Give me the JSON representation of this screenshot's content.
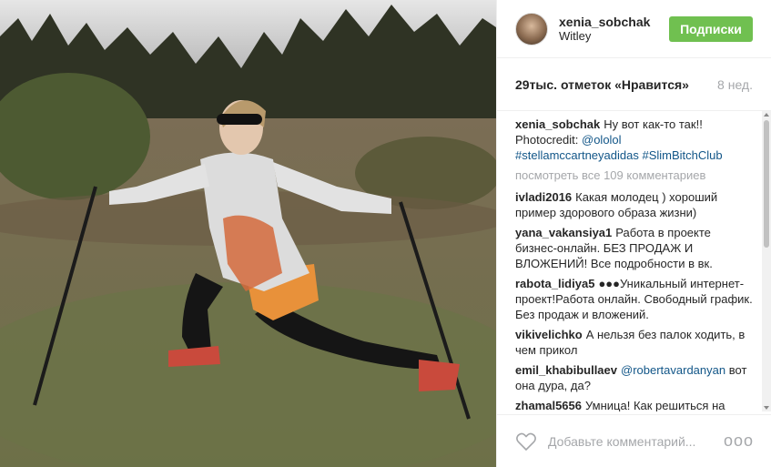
{
  "post": {
    "username": "xenia_sobchak",
    "location": "Witley",
    "follow_label": "Подписки",
    "likes": "29тыс. отметок «Нравится»",
    "time_ago": "8 нед."
  },
  "caption": {
    "author": "xenia_sobchak",
    "text": "Ну вот как-то так!! Photocredit:",
    "mention": "@ololol",
    "tags": "#stellamccartneyadidas #SlimBitchClub"
  },
  "view_all": "посмотреть все 109 комментариев",
  "comments": [
    {
      "author": "ivladi2016",
      "text": "Какая молодец ) хороший пример здорового образа жизни)"
    },
    {
      "author": "yana_vakansiya1",
      "text": "Работа в проекте бизнес-онлайн. БЕЗ ПРОДАЖ И ВЛОЖЕНИЙ! Все подробности в вк."
    },
    {
      "author": "rabota_lidiya5",
      "text": "●●●Уникальный интернет-проект!Работа онлайн. Свободный график. Без продаж и вложений."
    },
    {
      "author": "vikivelichko",
      "text": "А нельзя без палок ходить, в чем прикол"
    },
    {
      "author": "emil_khabibullaev",
      "mention": "@robertavardanyan",
      "text": "вот она дура, да?"
    },
    {
      "author": "zhamal5656",
      "text": "Умница! Как решиться на"
    }
  ],
  "footer": {
    "comment_placeholder": "Добавьте комментарий...",
    "more_label": "ooo",
    "icons": {
      "like": "heart-icon",
      "more": "more-options-icon"
    }
  },
  "colors": {
    "follow_button": "#70c050",
    "link": "#125688",
    "muted": "#a5a7aa"
  }
}
